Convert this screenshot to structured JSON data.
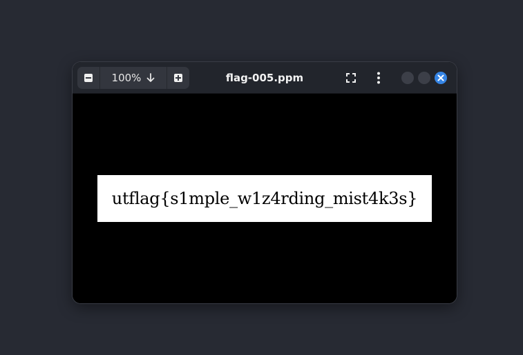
{
  "window": {
    "title": "flag-005.ppm"
  },
  "toolbar": {
    "zoom_out_icon": "zoom-out-icon",
    "zoom_value": "100%",
    "zoom_dropdown_icon": "arrow-down-icon",
    "zoom_in_icon": "zoom-in-icon",
    "fullscreen_icon": "fullscreen-icon",
    "menu_icon": "kebab-menu-icon"
  },
  "window_controls": {
    "minimize_icon": "minimize-icon",
    "maximize_icon": "maximize-icon",
    "close_icon": "close-icon",
    "close_color": "#3584e4"
  },
  "image": {
    "text": "utflag{s1mple_w1z4rding_mist4k3s}",
    "background": "#ffffff",
    "canvas_background": "#000000"
  }
}
